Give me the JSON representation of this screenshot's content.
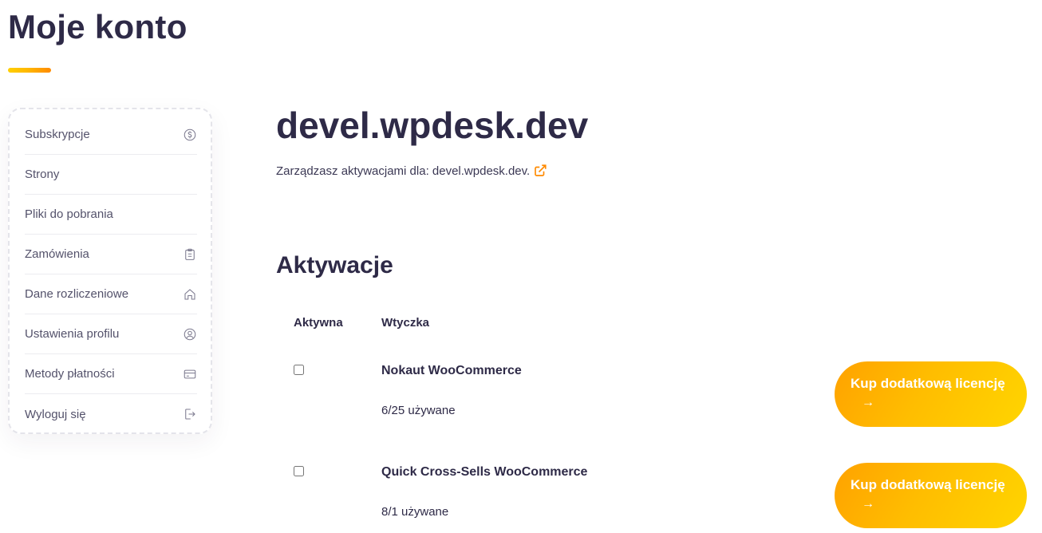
{
  "page": {
    "title": "Moje konto"
  },
  "sidebar": {
    "items": [
      {
        "label": "Subskrypcje",
        "icon": "dollar-circle-icon"
      },
      {
        "label": "Strony",
        "icon": ""
      },
      {
        "label": "Pliki do pobrania",
        "icon": ""
      },
      {
        "label": "Zamówienia",
        "icon": "clipboard-icon"
      },
      {
        "label": "Dane rozliczeniowe",
        "icon": "home-icon"
      },
      {
        "label": "Ustawienia profilu",
        "icon": "user-circle-icon"
      },
      {
        "label": "Metody płatności",
        "icon": "credit-card-icon"
      },
      {
        "label": "Wyloguj się",
        "icon": "logout-icon"
      }
    ]
  },
  "site": {
    "title": "devel.wpdesk.dev",
    "manage_text": "Zarządzasz aktywacjami dla: devel.wpdesk.dev."
  },
  "activations": {
    "title": "Aktywacje",
    "columns": [
      "Aktywna",
      "Wtyczka"
    ],
    "rows": [
      {
        "active": false,
        "plugin": "Nokaut WooCommerce",
        "usage": "6/25 używane",
        "button": "Kup dodatkową licencję",
        "arrow": "→"
      },
      {
        "active": false,
        "plugin": "Quick Cross-Sells WooCommerce",
        "usage": "8/1 używane",
        "button": "Kup dodatkową licencję",
        "arrow": "→"
      }
    ]
  },
  "colors": {
    "accent": "#ff8a00",
    "button_start": "#ffa200",
    "button_end": "#ffd500",
    "heading": "#2e2a47"
  }
}
